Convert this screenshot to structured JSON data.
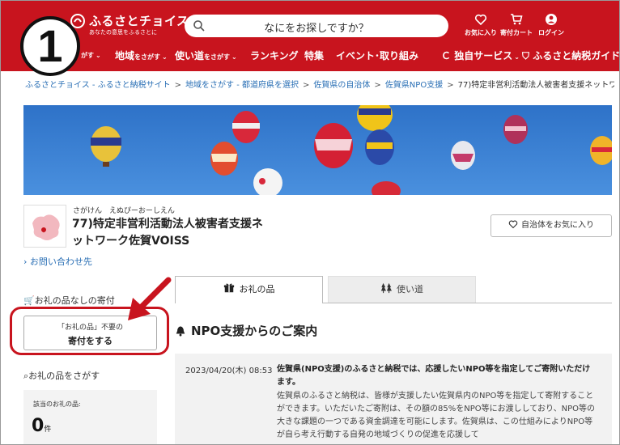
{
  "badge": {
    "number": "1"
  },
  "header": {
    "logo_text": "ふるさとチョイス",
    "logo_sub": "あなたの意思をふるさとに",
    "search_placeholder": "なにをお探しですか？",
    "icons": [
      {
        "label": "お気に入り",
        "icon": "heart-icon"
      },
      {
        "label": "寄付カート",
        "icon": "cart-icon"
      },
      {
        "label": "ログイン",
        "icon": "user-icon"
      }
    ],
    "nav": {
      "item1_suffix": "がす",
      "item2": {
        "main": "地域",
        "sub": "をさがす"
      },
      "item3": {
        "main": "使い道",
        "sub": "をさがす"
      },
      "item4": "ランキング",
      "item5": "特集",
      "item6": "イベント･取り組み",
      "item7": "独自サービス",
      "item8": "ふるさと納税ガイド"
    },
    "colors": {
      "brand": "#c8141e"
    }
  },
  "breadcrumb": {
    "items": [
      "ふるさとチョイス - ふるさと納税サイト",
      "地域をさがす - 都道府県を選択",
      "佐賀県の自治体",
      "佐賀県NPO支援",
      "77)特定非営利活動法人被害者支援ネットワー…"
    ]
  },
  "profile": {
    "ruby": "さがけん　えぬぴーおーしえん",
    "name": "77)特定非営利活動法人被害者支援ネットワーク佐賀VOISS",
    "fav_button": "自治体をお気に入り",
    "contact": "› お問い合わせ先"
  },
  "sidebar": {
    "no_gift_heading": "お礼の品なしの寄付",
    "donate_line1": "「お礼の品」不要の",
    "donate_line2": "寄付をする",
    "search_heading": "お礼の品をさがす",
    "count_label": "該当のお礼の品:",
    "count_value": "0",
    "count_unit": "件"
  },
  "tabs": {
    "gift": "お礼の品",
    "use": "使い道"
  },
  "section": {
    "title": "NPO支援からのご案内"
  },
  "notice": {
    "date": "2023/04/20(木) 08:53",
    "lead": "佐賀県(NPO支援)のふるさと納税では、応援したいNPO等を指定してご寄附いただけます。",
    "body": "佐賀県のふるさと納税は、皆様が支援したい佐賀県内のNPO等を指定して寄附することができます。いただいたご寄附は、その額の85%をNPO等にお渡ししており、NPO等の大きな課題の一つである資金調達を可能にします。佐賀県は、この仕組みによりNPO等が自ら考え行動する自発の地域づくりの促進を応援して"
  }
}
